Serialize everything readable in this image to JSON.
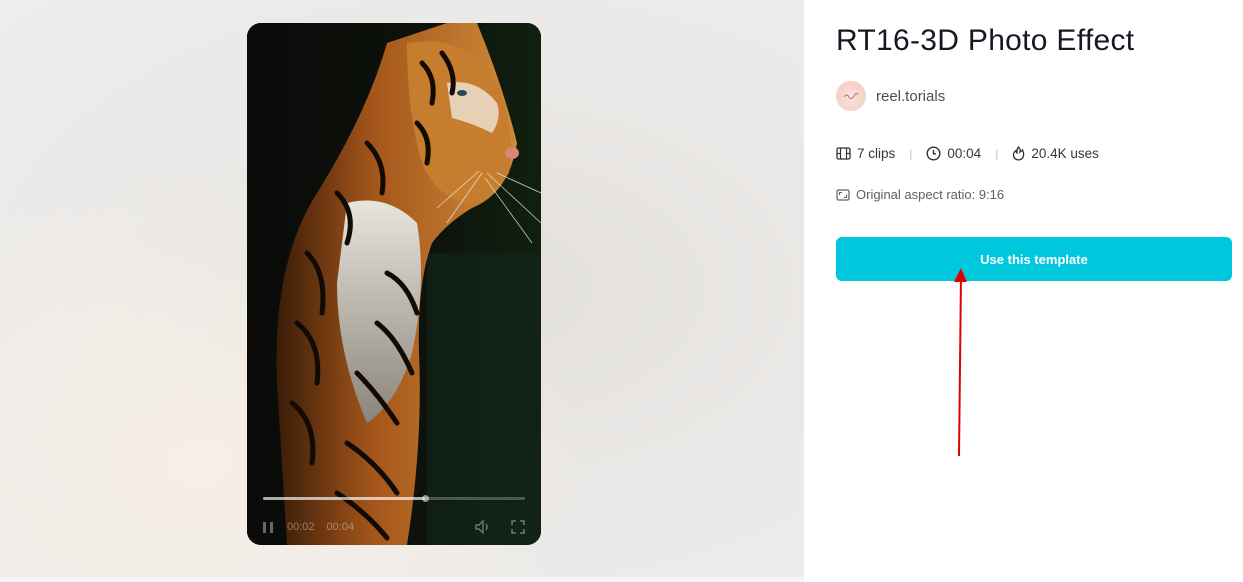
{
  "template": {
    "title": "RT16-3D Photo Effect",
    "author": {
      "name": "reel.torials",
      "avatar_icon": "avatar-logo"
    },
    "stats": {
      "clips": "7 clips",
      "duration": "00:04",
      "uses": "20.4K uses",
      "clips_icon": "film-icon",
      "duration_icon": "clock-icon",
      "uses_icon": "flame-icon"
    },
    "aspect_ratio": "Original aspect ratio: 9:16",
    "aspect_icon": "aspect-ratio-icon",
    "cta_label": "Use this template",
    "cta_color": "#00c8dc"
  },
  "player": {
    "current_time": "00:02",
    "total_time": "00:04",
    "progress": 0.62,
    "pause_icon": "pause-icon",
    "volume_icon": "volume-icon",
    "fullscreen_icon": "fullscreen-icon"
  },
  "annotation": {
    "color": "#e00000",
    "icon": "red-arrow-up"
  }
}
